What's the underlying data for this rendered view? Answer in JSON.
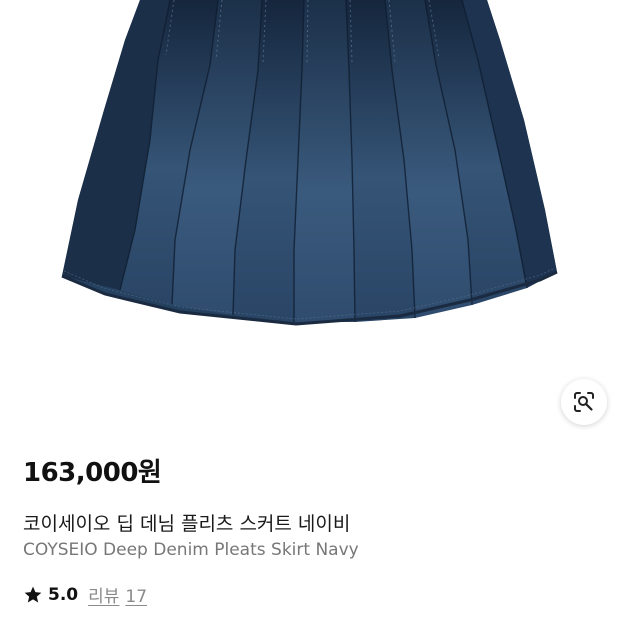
{
  "product": {
    "price": "163,000원",
    "name_kr": "코이세이오 딥 데님 플리츠 스커트 네이비",
    "name_en": "COYSEIO Deep Denim Pleats Skirt Navy",
    "rating": "5.0",
    "review_label": "리뷰",
    "review_count": "17"
  },
  "icons": {
    "image_search": "lens-search-icon",
    "rating_star": "star-icon"
  },
  "colors": {
    "denim_dark": "#1f3550",
    "denim_mid": "#2e4a6b",
    "text_primary": "#111111",
    "text_secondary": "#777777"
  }
}
